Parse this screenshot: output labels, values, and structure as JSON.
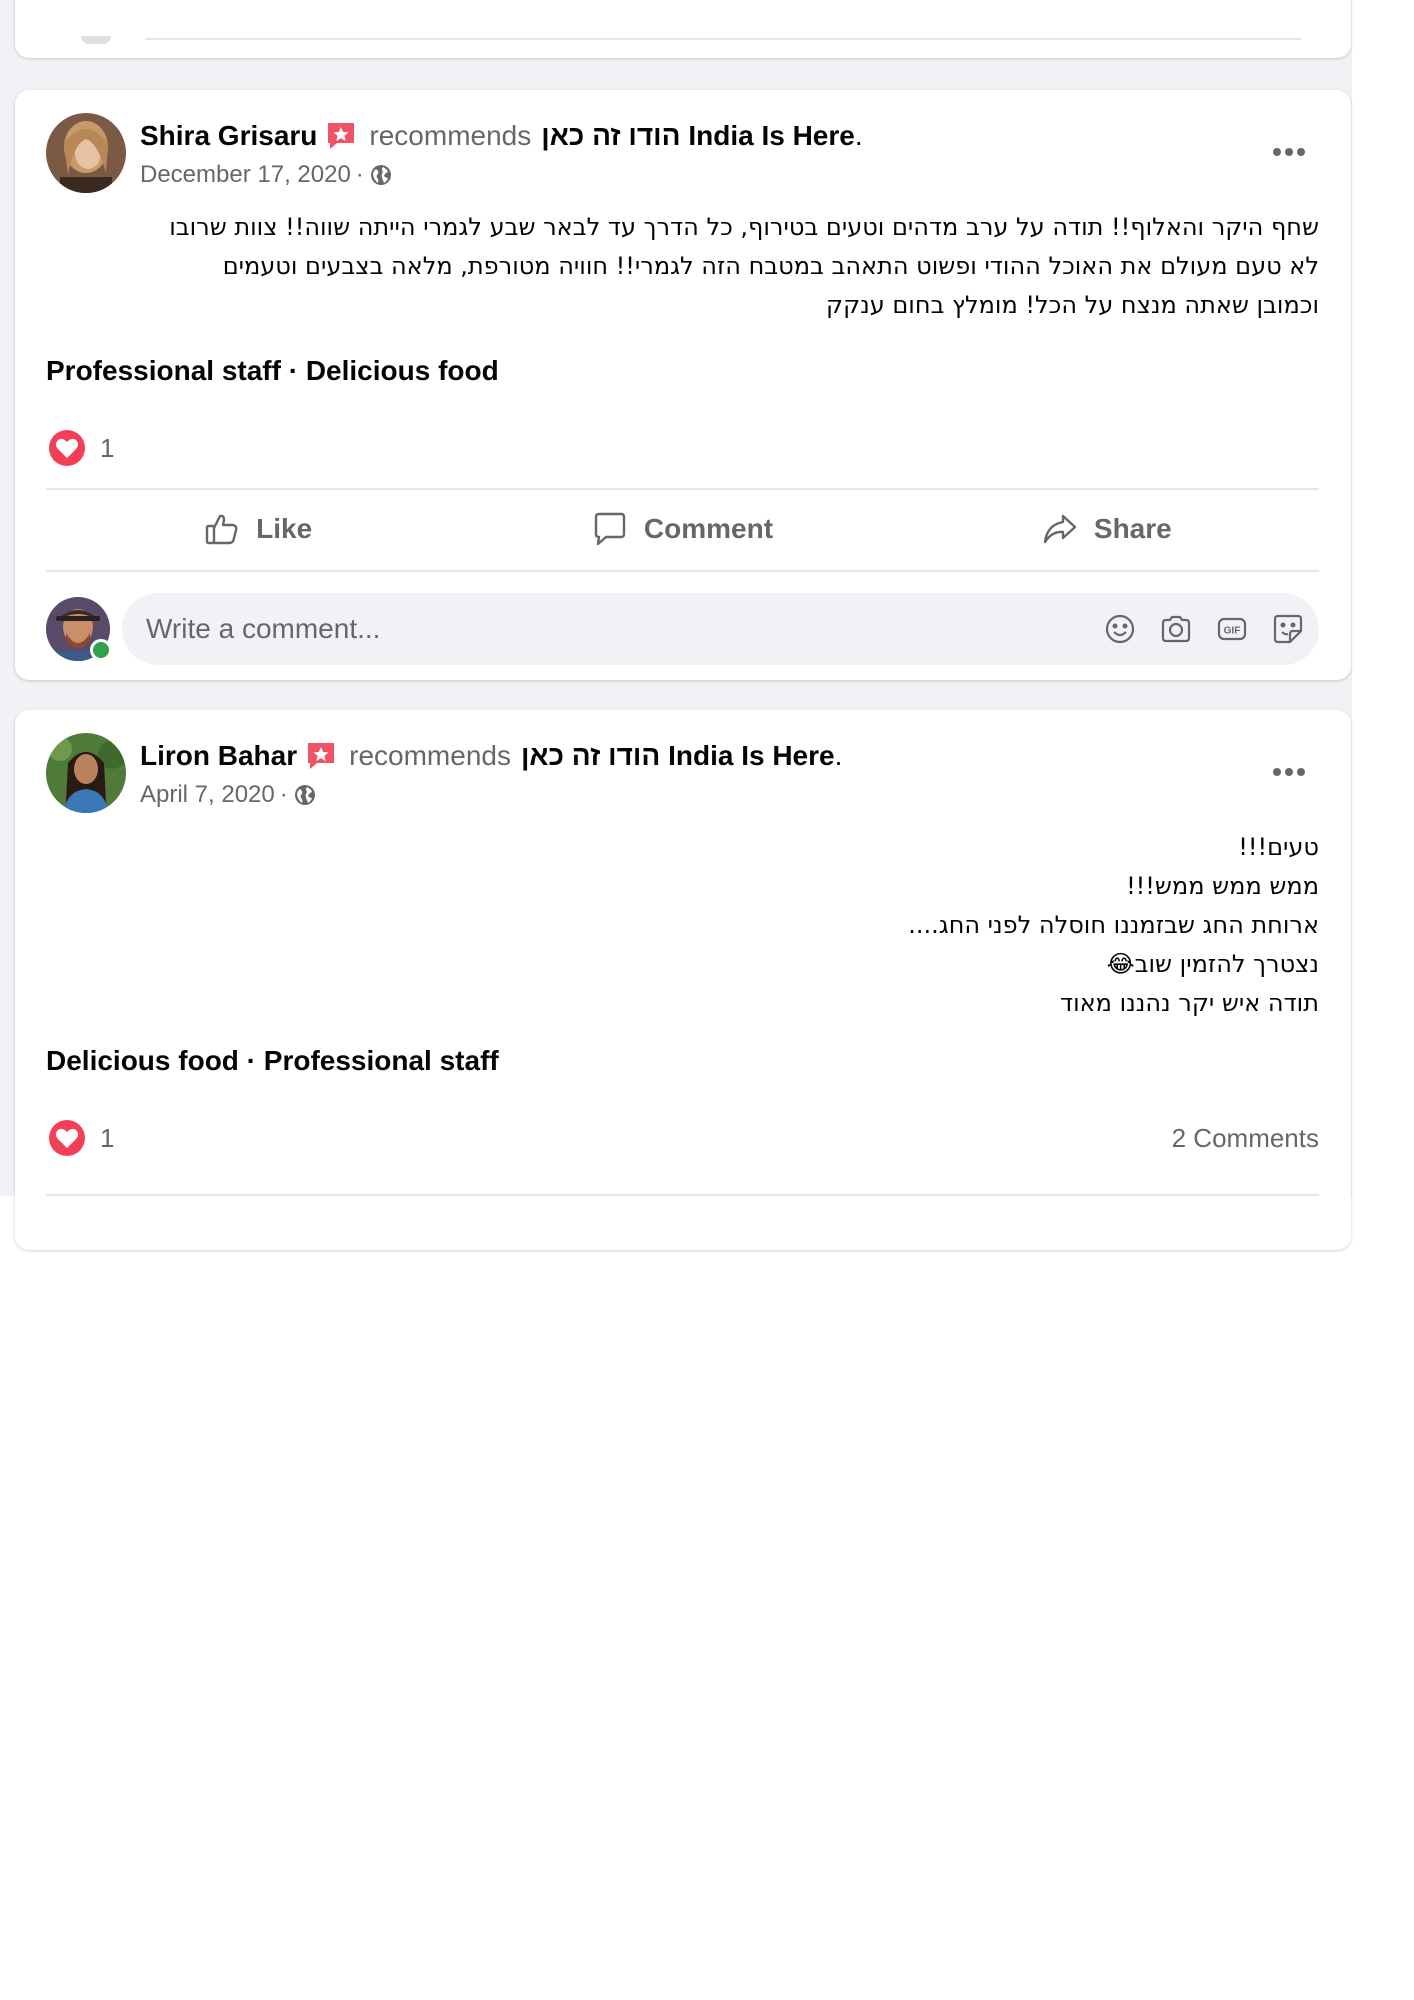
{
  "posts": [
    {
      "author": "Shira Grisaru",
      "recommends_label": "recommends",
      "page_name": "הודו זה כאן India Is Here",
      "period": ".",
      "date": "December 17, 2020",
      "date_separator": "·",
      "privacy_icon": "globe-icon",
      "text_lines": [
        "שחף היקר והאלוף!! תודה על ערב מדהים וטעים בטירוף, כל הדרך עד לבאר שבע לגמרי הייתה שווה!! צוות שרובו",
        "לא טעם מעולם את האוכל ההודי ופשוט התאהב במטבח הזה לגמרי!! חוויה מטורפת, מלאה בצבעים וטעמים",
        "וכמובן שאתה מנצח על הכל! מומלץ בחום ענקק"
      ],
      "tags": "Professional staff · Delicious food",
      "reaction_count": "1",
      "actions": {
        "like": "Like",
        "comment": "Comment",
        "share": "Share"
      },
      "comment_placeholder": "Write a comment..."
    },
    {
      "author": "Liron Bahar",
      "recommends_label": "recommends",
      "page_name": "הודו זה כאן India Is Here",
      "period": ".",
      "date": "April 7, 2020",
      "date_separator": "·",
      "privacy_icon": "globe-icon",
      "text_lines": [
        "טעים!!!",
        "ממש ממש ממש!!!",
        "ארוחת החג שבזמננו חוסלה לפני החג....",
        "נצטרך להזמין שוב😂",
        "תודה איש יקר נהננו מאוד"
      ],
      "tags": "Delicious food · Professional staff",
      "reaction_count": "1",
      "comments_count": "2 Comments"
    }
  ],
  "colors": {
    "feed_background": "#f0f2f5",
    "secondary_text": "#65676b",
    "heart_red": "#f33e58",
    "badge_red": "#f25268",
    "online_green": "#31a24c"
  }
}
